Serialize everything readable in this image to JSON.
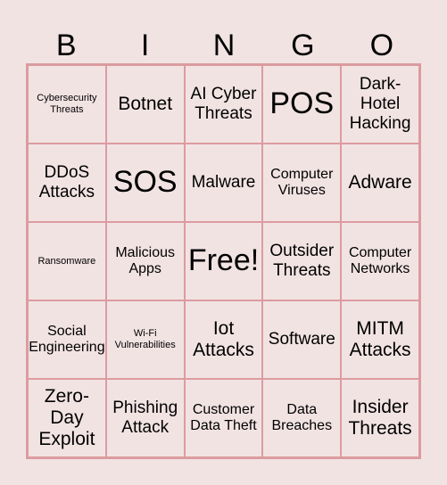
{
  "header": {
    "letters": [
      "B",
      "I",
      "N",
      "G",
      "O"
    ]
  },
  "colors": {
    "background": "#f2e3e3",
    "grid_border": "#dc9c9f",
    "text": "#000000"
  },
  "cells": [
    [
      "Cybersecurity Threats",
      "Botnet",
      "AI Cyber Threats",
      "POS",
      "Dark-Hotel Hacking"
    ],
    [
      "DDoS Attacks",
      "SOS",
      "Malware",
      "Computer Viruses",
      "Adware"
    ],
    [
      "Ransomware",
      "Malicious Apps",
      "Free!",
      "Outsider Threats",
      "Computer Networks"
    ],
    [
      "Social Engineering",
      "Wi-Fi Vulnerabilities",
      "Iot Attacks",
      "Software",
      "MITM Attacks"
    ],
    [
      "Zero-Day Exploit",
      "Phishing Attack",
      "Customer Data Theft",
      "Data Breaches",
      "Insider Threats"
    ]
  ],
  "free_space": {
    "label": "Free!",
    "row": 2,
    "col": 2
  }
}
